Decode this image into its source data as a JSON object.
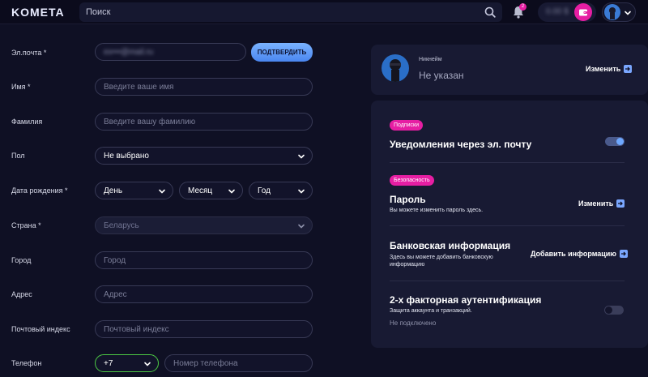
{
  "header": {
    "logo": "KOMETA",
    "search_placeholder": "Поиск",
    "notification_count": "2",
    "balance": "0.00 $"
  },
  "form": {
    "email": {
      "label": "Эл.почта *",
      "value": "ex•••@mail.ru",
      "confirm_label": "ПОДТВЕРДИТЬ"
    },
    "first_name": {
      "label": "Имя *",
      "placeholder": "Введите ваше имя"
    },
    "last_name": {
      "label": "Фамилия",
      "placeholder": "Введите вашу фамилию"
    },
    "gender": {
      "label": "Пол",
      "value": "Не выбрано"
    },
    "birth_date": {
      "label": "Дата рождения *",
      "day": "День",
      "month": "Месяц",
      "year": "Год"
    },
    "country": {
      "label": "Страна *",
      "value": "Беларусь"
    },
    "city": {
      "label": "Город",
      "placeholder": "Город"
    },
    "address": {
      "label": "Адрес",
      "placeholder": "Адрес"
    },
    "postal_code": {
      "label": "Почтовый индекс",
      "placeholder": "Почтовый индекс"
    },
    "phone": {
      "label": "Телефон",
      "code": "+7",
      "placeholder": "Номер телефона"
    }
  },
  "nickname_card": {
    "label": "Никнейм",
    "value": "Не указан",
    "edit_label": "Изменить"
  },
  "settings": {
    "subscriptions": {
      "badge": "Подписки",
      "title": "Уведомления через эл. почту",
      "enabled": true
    },
    "password": {
      "badge": "Безопасность",
      "title": "Пароль",
      "desc": "Вы можете изменить пароль здесь.",
      "action": "Изменить"
    },
    "bank": {
      "title": "Банковская информация",
      "desc_line1": "Здесь вы можете добавить банковскую",
      "desc_line2": "информацию",
      "action": "Добавить информацию"
    },
    "twofa": {
      "title": "2-х факторная аутентификация",
      "desc": "Защита аккаунта и транзакций.",
      "status": "Не подключено",
      "enabled": false
    }
  },
  "colors": {
    "background": "#0f1024",
    "card": "#181a33",
    "accent_pink": "#e61ea3",
    "accent_blue": "#6ea8ff",
    "phone_border": "#4cc944"
  }
}
